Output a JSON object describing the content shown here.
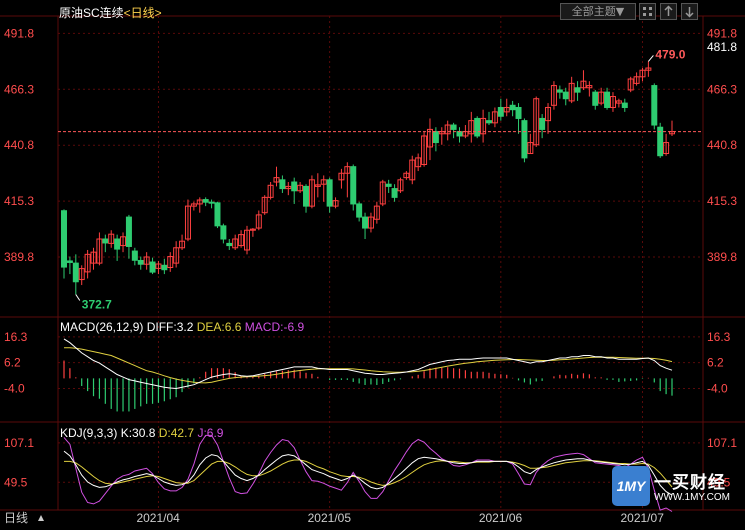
{
  "header": {
    "symbol": "原油SC连续",
    "period": "<日线>",
    "theme_label": "全部主题▼",
    "icon_buttons": [
      "grid-icon",
      "arrow-up-icon",
      "arrow-down-icon"
    ]
  },
  "colors": {
    "up": "#ff4040",
    "down": "#2ecc71",
    "grid": "#5a0a0a",
    "axis_label": "#ff4d4d",
    "price_line": "#ff5a5a",
    "macd_diff": "#ffffff",
    "macd_dea": "#e0d040",
    "macd_bar_neg": "#2ecc71",
    "macd_bar_pos": "#ff4040",
    "kdj_k": "#ffffff",
    "kdj_d": "#e0d040",
    "kdj_j": "#d050e0"
  },
  "last_price": "481.8",
  "high_marker": "479.0",
  "low_marker": "372.7",
  "macd_label": {
    "name": "MACD(26,12,9)",
    "diff": "DIFF:3.2",
    "dea": "DEA:6.6",
    "macd": "MACD:-6.9"
  },
  "kdj_label": {
    "name": "KDJ(9,3,3)",
    "k": "K:30.8",
    "d": "D:42.7",
    "j": "J:6.9"
  },
  "date_labels": [
    "2021/04",
    "2021/05",
    "2021/06",
    "2021/07"
  ],
  "corner_label": "日线",
  "watermark": {
    "cn": "一买财经",
    "url": "WWW.1MY.COM",
    "logo": "1MY"
  },
  "chart_data": [
    {
      "type": "candlestick",
      "name": "price",
      "y_ticks": [
        491.8,
        466.3,
        440.8,
        415.3,
        389.8
      ],
      "ylim": [
        372,
        497
      ],
      "candles": [
        [
          410.9,
          385.2,
          411.5,
          380.0
        ],
        [
          388.0,
          387.3,
          390.0,
          382.0
        ],
        [
          387.0,
          378.5,
          391.0,
          372.7
        ],
        [
          379.5,
          384.5,
          386.0,
          377.0
        ],
        [
          383.0,
          391.0,
          393.0,
          380.0
        ],
        [
          387.0,
          392.0,
          394.0,
          384.0
        ],
        [
          387.0,
          398.0,
          401.0,
          386.0
        ],
        [
          398.0,
          396.2,
          400.0,
          392.0
        ],
        [
          396.0,
          400.2,
          402.0,
          394.0
        ],
        [
          398.0,
          393.4,
          400.0,
          388.0
        ],
        [
          395.0,
          399.0,
          401.0,
          392.0
        ],
        [
          408.0,
          394.6,
          409.0,
          389.0
        ],
        [
          392.5,
          388.3,
          394.0,
          386.0
        ],
        [
          388.2,
          386.5,
          390.0,
          384.0
        ],
        [
          386.5,
          389.8,
          392.0,
          384.0
        ],
        [
          387.5,
          382.9,
          389.5,
          382.0
        ],
        [
          384.6,
          386.6,
          388.0,
          382.0
        ],
        [
          386.0,
          384.0,
          389.0,
          382.0
        ],
        [
          385.0,
          390.0,
          392.0,
          383.0
        ],
        [
          387.0,
          394.0,
          397.0,
          385.0
        ],
        [
          394.0,
          397.0,
          400.0,
          393.0
        ],
        [
          398.0,
          413.0,
          416.0,
          397.0
        ],
        [
          413.0,
          414.0,
          415.0,
          411.0
        ],
        [
          414.0,
          415.8,
          417.0,
          410.0
        ],
        [
          416.0,
          414.8,
          417.0,
          413.0
        ],
        [
          414.8,
          414.5,
          416.0,
          412.0
        ],
        [
          414.5,
          404.0,
          415.0,
          403.0
        ],
        [
          404.0,
          398.0,
          405.0,
          396.0
        ],
        [
          396.0,
          395.0,
          398.0,
          393.0
        ],
        [
          394.0,
          398.0,
          400.0,
          393.0
        ],
        [
          395.0,
          400.0,
          402.0,
          394.0
        ],
        [
          393.0,
          402.0,
          404.0,
          391.0
        ],
        [
          402.0,
          402.5,
          403.0,
          399.0
        ],
        [
          403.0,
          409.0,
          411.0,
          402.0
        ],
        [
          410.0,
          417.0,
          418.0,
          409.0
        ],
        [
          417.0,
          422.5,
          424.0,
          416.0
        ],
        [
          424.0,
          426.0,
          431.0,
          422.0
        ],
        [
          425.0,
          421.0,
          427.0,
          419.0
        ],
        [
          421.0,
          422.0,
          424.0,
          418.0
        ],
        [
          424.0,
          420.0,
          426.0,
          414.0
        ],
        [
          420.0,
          422.5,
          424.0,
          419.0
        ],
        [
          422.0,
          413.0,
          423.0,
          410.0
        ],
        [
          413.0,
          425.0,
          427.0,
          412.0
        ],
        [
          422.0,
          422.7,
          428.0,
          417.0
        ],
        [
          423.0,
          425.0,
          427.0,
          415.0
        ],
        [
          425.0,
          413.0,
          426.0,
          410.0
        ],
        [
          413.0,
          415.5,
          417.0,
          412.0
        ],
        [
          425.0,
          428.0,
          430.0,
          421.0
        ],
        [
          428.0,
          431.0,
          433.0,
          417.0
        ],
        [
          431.0,
          414.0,
          432.0,
          411.0
        ],
        [
          414.0,
          408.0,
          415.0,
          406.0
        ],
        [
          408.0,
          403.0,
          410.0,
          398.0
        ],
        [
          403.0,
          408.0,
          410.0,
          401.0
        ],
        [
          407.0,
          413.0,
          415.0,
          405.0
        ],
        [
          414.0,
          424.0,
          425.0,
          413.0
        ],
        [
          423.0,
          422.0,
          425.0,
          419.0
        ],
        [
          421.0,
          417.0,
          423.0,
          415.0
        ],
        [
          420.0,
          425.0,
          426.0,
          419.0
        ],
        [
          426.0,
          428.0,
          429.0,
          425.0
        ],
        [
          425.0,
          434.0,
          436.0,
          423.0
        ],
        [
          431.0,
          435.0,
          437.0,
          429.0
        ],
        [
          432.0,
          445.0,
          447.0,
          431.0
        ],
        [
          440.0,
          448.0,
          453.0,
          434.0
        ],
        [
          447.0,
          442.0,
          449.0,
          438.0
        ],
        [
          446.0,
          447.0,
          449.0,
          441.0
        ],
        [
          446.0,
          450.0,
          452.0,
          443.0
        ],
        [
          450.0,
          448.0,
          451.0,
          444.0
        ],
        [
          447.0,
          445.0,
          449.0,
          442.0
        ],
        [
          445.0,
          447.0,
          450.0,
          444.0
        ],
        [
          446.0,
          452.0,
          456.0,
          442.0
        ],
        [
          453.0,
          445.0,
          454.0,
          444.0
        ],
        [
          446.0,
          453.0,
          457.0,
          442.0
        ],
        [
          452.0,
          451.0,
          456.0,
          450.0
        ],
        [
          451.0,
          456.0,
          458.0,
          449.0
        ],
        [
          458.0,
          454.0,
          462.0,
          452.0
        ],
        [
          456.0,
          458.0,
          462.0,
          454.0
        ],
        [
          459.0,
          457.0,
          461.0,
          454.0
        ],
        [
          458.0,
          453.0,
          460.0,
          446.0
        ],
        [
          452.0,
          435.0,
          453.0,
          433.0
        ],
        [
          437.0,
          442.0,
          446.0,
          437.0
        ],
        [
          441.0,
          462.0,
          463.0,
          440.0
        ],
        [
          453.0,
          448.0,
          455.0,
          444.0
        ],
        [
          452.0,
          458.0,
          460.0,
          446.0
        ],
        [
          459.0,
          468.0,
          470.0,
          457.0
        ],
        [
          466.0,
          465.0,
          468.0,
          462.0
        ],
        [
          465.0,
          462.0,
          467.0,
          459.0
        ],
        [
          461.0,
          469.0,
          472.0,
          460.0
        ],
        [
          467.0,
          465.0,
          470.0,
          461.0
        ],
        [
          467.0,
          470.0,
          475.0,
          466.0
        ],
        [
          467.0,
          468.0,
          470.0,
          463.0
        ],
        [
          465.0,
          459.0,
          466.0,
          457.0
        ],
        [
          460.0,
          465.0,
          467.0,
          459.0
        ],
        [
          465.0,
          458.0,
          467.0,
          457.0
        ],
        [
          458.0,
          463.0,
          465.0,
          456.0
        ],
        [
          460.0,
          461.0,
          462.0,
          458.0
        ],
        [
          460.0,
          458.0,
          462.0,
          456.0
        ],
        [
          466.0,
          471.0,
          472.0,
          465.0
        ],
        [
          469.0,
          472.0,
          474.0,
          468.0
        ],
        [
          472.0,
          475.0,
          476.0,
          470.0
        ],
        [
          475.0,
          476.0,
          479.0,
          472.0
        ],
        [
          468.0,
          450.0,
          469.0,
          448.0
        ],
        [
          449.0,
          436.0,
          451.0,
          435.0
        ],
        [
          437.0,
          442.0,
          446.0,
          436.0
        ],
        [
          446.0,
          447.0,
          452.0,
          445.0
        ]
      ]
    },
    {
      "type": "macd",
      "name": "MACD(26,12,9)",
      "y_ticks": [
        16.3,
        6.2,
        -4.0
      ],
      "ylim": [
        -14,
        19
      ],
      "diff": [
        15.5,
        14.0,
        12.0,
        10.0,
        8.5,
        7.0,
        6.0,
        4.5,
        3.0,
        1.5,
        0.5,
        -0.5,
        -1.0,
        -1.5,
        -2.0,
        -2.5,
        -3.0,
        -3.5,
        -3.8,
        -4.0,
        -3.5,
        -3.0,
        -2.5,
        -1.5,
        -0.5,
        0.5,
        1.0,
        1.5,
        1.8,
        1.5,
        1.0,
        0.8,
        1.0,
        1.5,
        2.0,
        2.5,
        3.0,
        3.5,
        4.0,
        4.5,
        4.5,
        4.5,
        4.5,
        4.0,
        3.8,
        3.5,
        3.5,
        3.5,
        3.5,
        3.0,
        2.5,
        2.0,
        1.8,
        1.5,
        1.5,
        1.8,
        2.0,
        2.2,
        2.5,
        3.0,
        3.5,
        4.5,
        5.5,
        6.0,
        6.5,
        7.0,
        7.2,
        7.5,
        7.5,
        7.5,
        7.8,
        8.0,
        8.0,
        8.0,
        8.0,
        8.0,
        7.5,
        7.0,
        6.5,
        6.0,
        6.5,
        6.5,
        7.0,
        7.5,
        8.0,
        8.0,
        8.5,
        8.5,
        9.0,
        9.0,
        8.5,
        8.5,
        8.0,
        8.0,
        7.5,
        7.5,
        7.5,
        7.5,
        7.8,
        8.0,
        7.0,
        5.0,
        4.0,
        3.2
      ],
      "dea": [
        12.0,
        12.0,
        11.8,
        11.5,
        11.0,
        10.5,
        10.0,
        9.5,
        9.0,
        8.0,
        7.0,
        6.0,
        5.0,
        4.0,
        3.0,
        2.5,
        1.8,
        1.0,
        0.3,
        -0.3,
        -0.8,
        -1.2,
        -1.5,
        -1.7,
        -1.8,
        -1.5,
        -1.0,
        -0.5,
        0.0,
        0.3,
        0.5,
        0.6,
        0.7,
        0.9,
        1.1,
        1.3,
        1.6,
        2.0,
        2.4,
        2.8,
        3.1,
        3.4,
        3.6,
        3.7,
        3.8,
        3.8,
        3.8,
        3.8,
        3.8,
        3.7,
        3.5,
        3.3,
        3.0,
        2.8,
        2.6,
        2.5,
        2.4,
        2.4,
        2.5,
        2.6,
        2.8,
        3.1,
        3.5,
        3.9,
        4.4,
        4.8,
        5.2,
        5.6,
        5.9,
        6.2,
        6.5,
        6.7,
        6.9,
        7.1,
        7.2,
        7.3,
        7.4,
        7.4,
        7.3,
        7.2,
        7.1,
        7.0,
        7.0,
        7.1,
        7.3,
        7.4,
        7.6,
        7.8,
        8.0,
        8.2,
        8.3,
        8.3,
        8.3,
        8.3,
        8.2,
        8.1,
        8.0,
        7.9,
        7.9,
        7.9,
        7.8,
        7.5,
        7.1,
        6.6
      ]
    },
    {
      "type": "kdj",
      "name": "KDJ(9,3,3)",
      "y_ticks": [
        107.1,
        49.5
      ],
      "ylim": [
        12,
        120
      ],
      "k": [
        95.0,
        88.0,
        75.0,
        60.0,
        50.0,
        45.0,
        42.0,
        43.0,
        46.0,
        50.0,
        53.0,
        55.0,
        58.0,
        60.0,
        62.0,
        60.0,
        55.0,
        50.0,
        47.0,
        45.0,
        46.0,
        50.0,
        60.0,
        75.0,
        85.0,
        90.0,
        88.0,
        80.0,
        70.0,
        60.0,
        55.0,
        52.0,
        55.0,
        60.0,
        68.0,
        75.0,
        82.0,
        88.0,
        90.0,
        88.0,
        82.0,
        75.0,
        68.0,
        65.0,
        62.0,
        58.0,
        55.0,
        52.0,
        55.0,
        60.0,
        55.0,
        48.0,
        42.0,
        40.0,
        42.0,
        48.0,
        55.0,
        62.0,
        70.0,
        78.0,
        84.0,
        86.0,
        85.0,
        84.0,
        82.0,
        80.0,
        78.0,
        77.0,
        77.0,
        78.0,
        80.0,
        80.0,
        80.0,
        80.0,
        80.0,
        80.0,
        78.0,
        72.0,
        65.0,
        62.0,
        68.0,
        72.0,
        75.0,
        78.0,
        80.0,
        82.0,
        83.0,
        84.0,
        84.0,
        82.0,
        80.0,
        79.0,
        78.0,
        77.0,
        76.0,
        75.0,
        76.0,
        78.0,
        80.0,
        74.0,
        60.0,
        45.0,
        36.0,
        30.8
      ],
      "d": [
        80.0,
        80.0,
        78.0,
        72.0,
        65.0,
        58.0,
        52.0,
        48.0,
        47.0,
        48.0,
        50.0,
        52.0,
        54.0,
        56.0,
        58.0,
        59.0,
        58.0,
        55.0,
        52.0,
        49.0,
        48.0,
        48.0,
        52.0,
        60.0,
        68.0,
        76.0,
        80.0,
        80.0,
        77.0,
        72.0,
        66.0,
        61.0,
        59.0,
        59.0,
        62.0,
        66.0,
        71.0,
        76.0,
        80.0,
        82.0,
        82.0,
        80.0,
        76.0,
        72.0,
        69.0,
        65.0,
        62.0,
        59.0,
        58.0,
        58.0,
        57.0,
        54.0,
        50.0,
        47.0,
        45.0,
        46.0,
        49.0,
        53.0,
        58.0,
        64.0,
        70.0,
        75.0,
        78.0,
        80.0,
        81.0,
        80.0,
        80.0,
        79.0,
        78.0,
        78.0,
        79.0,
        79.0,
        79.0,
        80.0,
        80.0,
        80.0,
        79.0,
        77.0,
        74.0,
        70.0,
        70.0,
        71.0,
        72.0,
        74.0,
        76.0,
        78.0,
        79.0,
        80.0,
        81.0,
        81.0,
        81.0,
        80.0,
        79.0,
        78.0,
        77.0,
        77.0,
        76.0,
        76.0,
        77.0,
        76.0,
        71.0,
        63.0,
        53.0,
        42.7
      ],
      "j": [
        115.0,
        105.0,
        70.0,
        35.0,
        20.0,
        18.0,
        22.0,
        33.0,
        44.0,
        54.0,
        59.0,
        61.0,
        66.0,
        68.0,
        70.0,
        62.0,
        49.0,
        40.0,
        37.0,
        37.0,
        42.0,
        54.0,
        76.0,
        105.0,
        118.0,
        118.0,
        104.0,
        80.0,
        56.0,
        36.0,
        33.0,
        34.0,
        47.0,
        62.0,
        80.0,
        93.0,
        104.0,
        112.0,
        110.0,
        100.0,
        82.0,
        65.0,
        52.0,
        51.0,
        48.0,
        44.0,
        41.0,
        38.0,
        49.0,
        64.0,
        51.0,
        36.0,
        26.0,
        26.0,
        36.0,
        52.0,
        67.0,
        80.0,
        94.0,
        106.0,
        112.0,
        108.0,
        99.0,
        92.0,
        84.0,
        80.0,
        74.0,
        73.0,
        75.0,
        78.0,
        82.0,
        82.0,
        82.0,
        80.0,
        80.0,
        80.0,
        76.0,
        62.0,
        47.0,
        46.0,
        64.0,
        74.0,
        81.0,
        86.0,
        88.0,
        90.0,
        91.0,
        92.0,
        90.0,
        84.0,
        78.0,
        77.0,
        76.0,
        75.0,
        74.0,
        71.0,
        76.0,
        82.0,
        86.0,
        70.0,
        38.0,
        9.0,
        12.0,
        6.9
      ]
    }
  ]
}
